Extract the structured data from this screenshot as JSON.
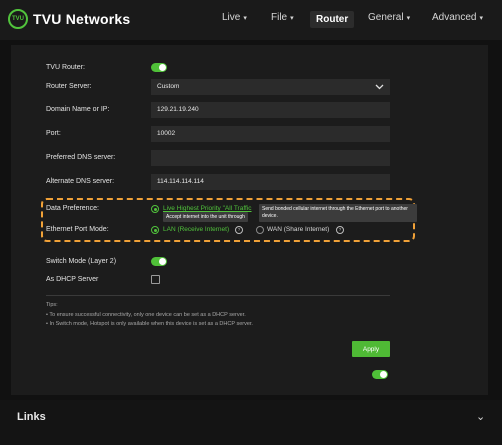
{
  "header": {
    "logo_badge": "TVU",
    "brand": "TVU Networks",
    "nav": [
      {
        "label": "Live",
        "has_caret": true
      },
      {
        "label": "File",
        "has_caret": true
      },
      {
        "label": "Router",
        "has_caret": false,
        "active": true
      },
      {
        "label": "General",
        "has_caret": true
      },
      {
        "label": "Advanced",
        "has_caret": true
      }
    ],
    "caret": "▾"
  },
  "router": {
    "tvu_router_label": "TVU Router:",
    "tvu_router_on": true,
    "server_label": "Router Server:",
    "server_value": "Custom",
    "domain_label": "Domain Name or IP:",
    "domain_value": "129.21.19.240",
    "port_label": "Port:",
    "port_value": "10002",
    "pref_dns_label": "Preferred DNS server:",
    "pref_dns_value": "",
    "alt_dns_label": "Alternate DNS server:",
    "alt_dns_value": "114.114.114.114",
    "data_pref_label": "Data Preference:",
    "data_pref_option": "Live Highest Priority  \"All Traffic",
    "tooltip_1": "Accept internet into the unit through",
    "tooltip_2": "Send bonded cellular internet through the Ethernet port to another device.",
    "eth_mode_label": "Ethernet Port Mode:",
    "eth_lan": "LAN (Receive Internet)",
    "eth_wan": "WAN (Share Internet)",
    "eth_selected": "LAN",
    "switch_mode_label": "Switch Mode (Layer 2)",
    "switch_mode_on": true,
    "dhcp_label": "As DHCP Server",
    "dhcp_checked": false,
    "tips_title": "Tips:",
    "tip_1": "• To ensure successful connectivity, only one device can be set as a DHCP server.",
    "tip_2": "• In Switch mode, Hotspot is only available when this device is set as a DHCP server.",
    "apply_label": "Apply",
    "bottom_toggle_on": true
  },
  "links": {
    "title": "Links",
    "chevron": "⌄"
  },
  "colors": {
    "accent": "#51c33c",
    "highlight": "#f0a138",
    "panel": "#1c1c1c",
    "field": "#2b2b2b"
  },
  "icons": [
    "chevron-down-icon",
    "help-circle-icon",
    "toggle-on",
    "checkbox-empty"
  ]
}
